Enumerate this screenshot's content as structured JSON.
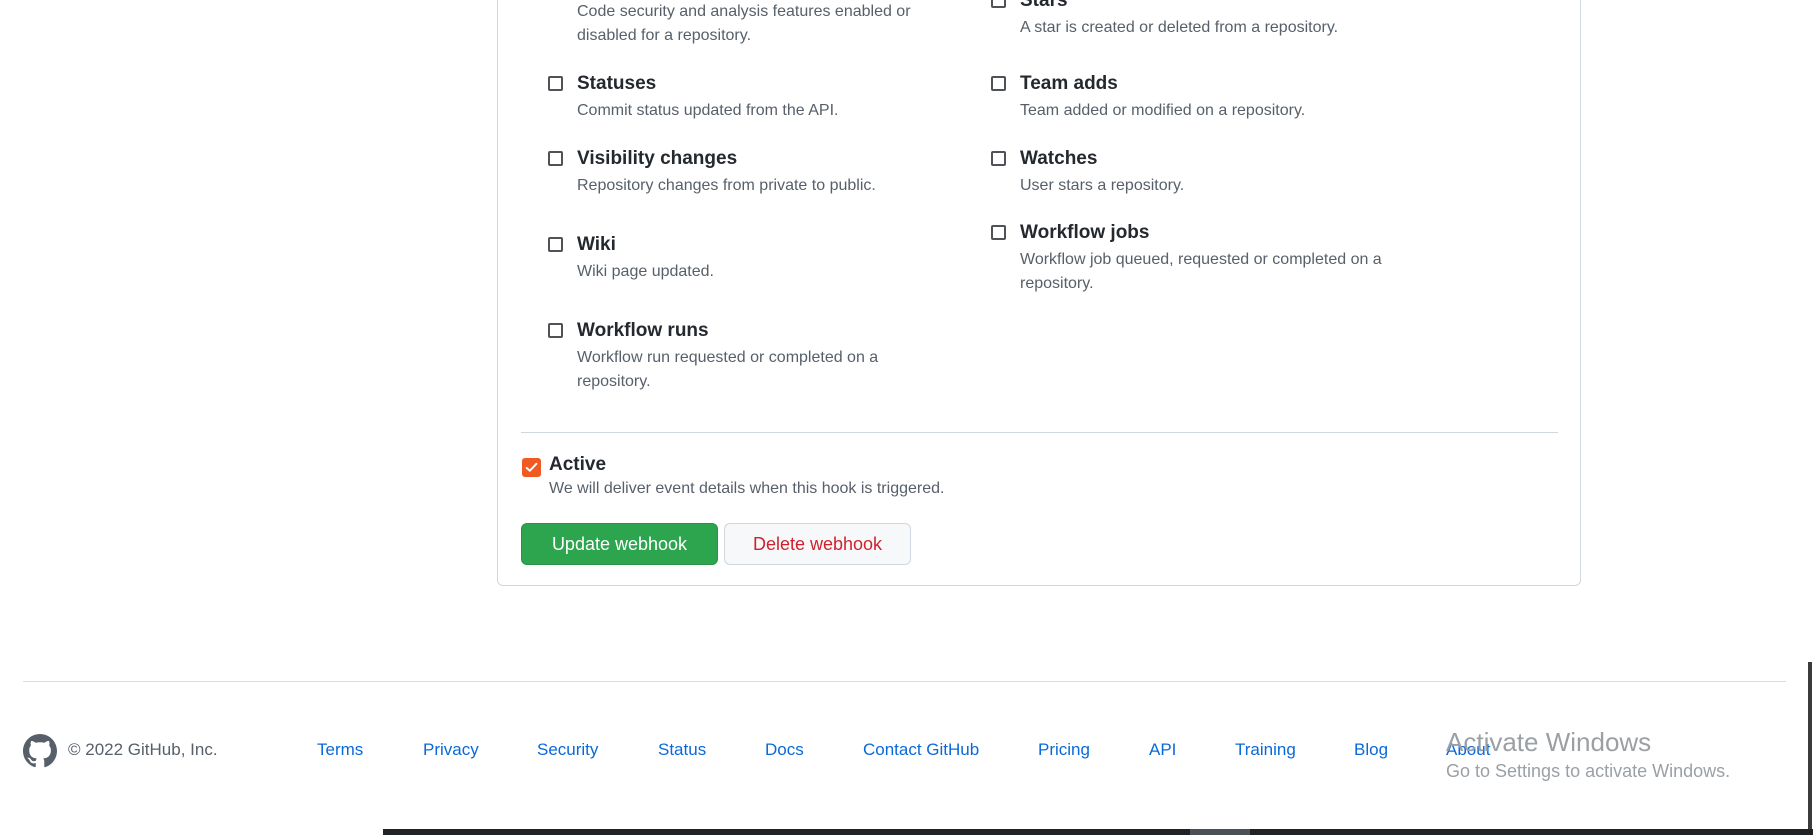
{
  "events": {
    "code_scanning": {
      "title": "",
      "desc": "Code security and analysis features enabled or disabled for a repository."
    },
    "stars": {
      "title": "Stars",
      "desc": "A star is created or deleted from a repository."
    },
    "statuses": {
      "title": "Statuses",
      "desc": "Commit status updated from the API."
    },
    "team_adds": {
      "title": "Team adds",
      "desc": "Team added or modified on a repository."
    },
    "visibility_changes": {
      "title": "Visibility changes",
      "desc": "Repository changes from private to public."
    },
    "watches": {
      "title": "Watches",
      "desc": "User stars a repository."
    },
    "wiki": {
      "title": "Wiki",
      "desc": "Wiki page updated."
    },
    "workflow_jobs": {
      "title": "Workflow jobs",
      "desc": "Workflow job queued, requested or completed on a repository."
    },
    "workflow_runs": {
      "title": "Workflow runs",
      "desc": "Workflow run requested or completed on a repository."
    }
  },
  "active": {
    "title": "Active",
    "desc": "We will deliver event details when this hook is triggered.",
    "checked": true
  },
  "buttons": {
    "update": "Update webhook",
    "delete": "Delete webhook"
  },
  "footer": {
    "copyright": "© 2022 GitHub, Inc.",
    "links": [
      "Terms",
      "Privacy",
      "Security",
      "Status",
      "Docs",
      "Contact GitHub",
      "Pricing",
      "API",
      "Training",
      "Blog",
      "About"
    ]
  },
  "watermark": {
    "line1": "Activate Windows",
    "line2": "Go to Settings to activate Windows."
  },
  "colors": {
    "accent_green": "#2da44e",
    "danger_red": "#cf222e",
    "checkbox_orange": "#f05a22",
    "link_blue": "#0969da"
  },
  "icons": [
    "github-mark-icon",
    "checkmark-icon"
  ]
}
